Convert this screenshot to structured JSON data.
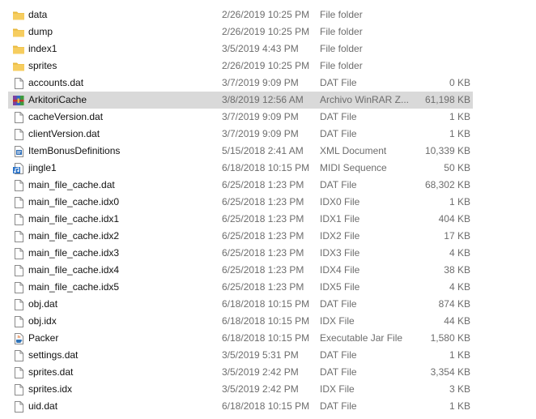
{
  "files": [
    {
      "name": "data",
      "date": "2/26/2019 10:25 PM",
      "type": "File folder",
      "size": "",
      "icon": "folder-icon"
    },
    {
      "name": "dump",
      "date": "2/26/2019 10:25 PM",
      "type": "File folder",
      "size": "",
      "icon": "folder-icon"
    },
    {
      "name": "index1",
      "date": "3/5/2019 4:43 PM",
      "type": "File folder",
      "size": "",
      "icon": "folder-icon"
    },
    {
      "name": "sprites",
      "date": "2/26/2019 10:25 PM",
      "type": "File folder",
      "size": "",
      "icon": "folder-icon"
    },
    {
      "name": "accounts.dat",
      "date": "3/7/2019 9:09 PM",
      "type": "DAT File",
      "size": "0 KB",
      "icon": "file-icon"
    },
    {
      "name": "ArkitoriCache",
      "date": "3/8/2019 12:56 AM",
      "type": "Archivo WinRAR Z...",
      "size": "61,198 KB",
      "icon": "winrar-archive-icon"
    },
    {
      "name": "cacheVersion.dat",
      "date": "3/7/2019 9:09 PM",
      "type": "DAT File",
      "size": "1 KB",
      "icon": "file-icon"
    },
    {
      "name": "clientVersion.dat",
      "date": "3/7/2019 9:09 PM",
      "type": "DAT File",
      "size": "1 KB",
      "icon": "file-icon"
    },
    {
      "name": "ItemBonusDefinitions",
      "date": "5/15/2018 2:41 AM",
      "type": "XML Document",
      "size": "10,339 KB",
      "icon": "xml-document-icon"
    },
    {
      "name": "jingle1",
      "date": "6/18/2018 10:15 PM",
      "type": "MIDI Sequence",
      "size": "50 KB",
      "icon": "midi-sequence-icon"
    },
    {
      "name": "main_file_cache.dat",
      "date": "6/25/2018 1:23 PM",
      "type": "DAT File",
      "size": "68,302 KB",
      "icon": "file-icon"
    },
    {
      "name": "main_file_cache.idx0",
      "date": "6/25/2018 1:23 PM",
      "type": "IDX0 File",
      "size": "1 KB",
      "icon": "file-icon"
    },
    {
      "name": "main_file_cache.idx1",
      "date": "6/25/2018 1:23 PM",
      "type": "IDX1 File",
      "size": "404 KB",
      "icon": "file-icon"
    },
    {
      "name": "main_file_cache.idx2",
      "date": "6/25/2018 1:23 PM",
      "type": "IDX2 File",
      "size": "17 KB",
      "icon": "file-icon"
    },
    {
      "name": "main_file_cache.idx3",
      "date": "6/25/2018 1:23 PM",
      "type": "IDX3 File",
      "size": "4 KB",
      "icon": "file-icon"
    },
    {
      "name": "main_file_cache.idx4",
      "date": "6/25/2018 1:23 PM",
      "type": "IDX4 File",
      "size": "38 KB",
      "icon": "file-icon"
    },
    {
      "name": "main_file_cache.idx5",
      "date": "6/25/2018 1:23 PM",
      "type": "IDX5 File",
      "size": "4 KB",
      "icon": "file-icon"
    },
    {
      "name": "obj.dat",
      "date": "6/18/2018 10:15 PM",
      "type": "DAT File",
      "size": "874 KB",
      "icon": "file-icon"
    },
    {
      "name": "obj.idx",
      "date": "6/18/2018 10:15 PM",
      "type": "IDX File",
      "size": "44 KB",
      "icon": "file-icon"
    },
    {
      "name": "Packer",
      "date": "6/18/2018 10:15 PM",
      "type": "Executable Jar File",
      "size": "1,580 KB",
      "icon": "java-jar-icon"
    },
    {
      "name": "settings.dat",
      "date": "3/5/2019 5:31 PM",
      "type": "DAT File",
      "size": "1 KB",
      "icon": "file-icon"
    },
    {
      "name": "sprites.dat",
      "date": "3/5/2019 2:42 PM",
      "type": "DAT File",
      "size": "3,354 KB",
      "icon": "file-icon"
    },
    {
      "name": "sprites.idx",
      "date": "3/5/2019 2:42 PM",
      "type": "IDX File",
      "size": "3 KB",
      "icon": "file-icon"
    },
    {
      "name": "uid.dat",
      "date": "6/18/2018 10:15 PM",
      "type": "DAT File",
      "size": "1 KB",
      "icon": "file-icon"
    }
  ],
  "selected_index": 5,
  "colors": {
    "selection": "#d9d9d9",
    "folder": "#f4c95d",
    "secondary_text": "#6d6d6d"
  }
}
